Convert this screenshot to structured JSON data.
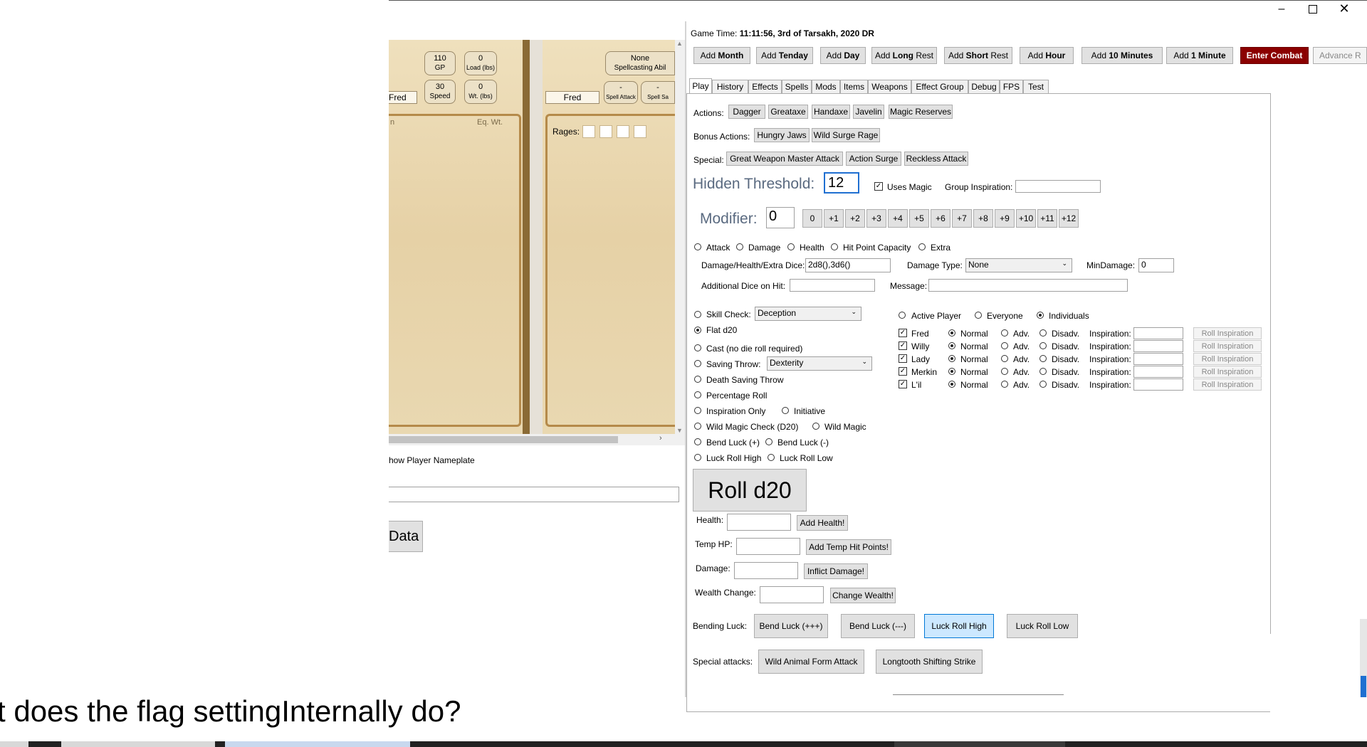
{
  "window": {
    "minimize_icon": "minimize-icon",
    "maximize_icon": "maximize-icon",
    "close_icon": "close-icon"
  },
  "game_time": {
    "label": "Game Time:",
    "value": "11:11:56, 3rd of Tarsakh, 2020 DR"
  },
  "time_buttons": [
    {
      "prefix": "Add ",
      "bold": "Month"
    },
    {
      "prefix": "Add ",
      "bold": "Tenday"
    },
    {
      "prefix": "Add ",
      "bold": "Day"
    },
    {
      "prefix": "Add ",
      "bold": "Long",
      "suffix": " Rest"
    },
    {
      "prefix": "Add ",
      "bold": "Short",
      "suffix": " Rest"
    },
    {
      "prefix": "Add ",
      "bold": "Hour"
    },
    {
      "prefix": "Add ",
      "bold": "10 Minutes"
    },
    {
      "prefix": "Add ",
      "bold": "1 Minute"
    }
  ],
  "enter_combat": "Enter Combat",
  "advance": "Advance R",
  "tabs": [
    "Play",
    "History",
    "Effects",
    "Spells",
    "Mods",
    "Items",
    "Weapons",
    "Effect Group",
    "Debug",
    "FPS",
    "Test"
  ],
  "actions": {
    "label": "Actions:",
    "items": [
      "Dagger",
      "Greataxe",
      "Handaxe",
      "Javelin",
      "Magic Reserves"
    ]
  },
  "bonus_actions": {
    "label": "Bonus Actions:",
    "items": [
      "Hungry Jaws",
      "Wild Surge Rage"
    ]
  },
  "special": {
    "label": "Special:",
    "items": [
      "Great Weapon Master Attack",
      "Action Surge",
      "Reckless Attack"
    ]
  },
  "hidden_threshold": {
    "label": "Hidden Threshold:",
    "value": "12"
  },
  "uses_magic": {
    "label": "Uses Magic",
    "checked": true
  },
  "group_inspiration": {
    "label": "Group Inspiration:",
    "value": ""
  },
  "modifier": {
    "label": "Modifier:",
    "value": "0",
    "buttons": [
      "0",
      "+1",
      "+2",
      "+3",
      "+4",
      "+5",
      "+6",
      "+7",
      "+8",
      "+9",
      "+10",
      "+11",
      "+12"
    ]
  },
  "roll_type": [
    "Attack",
    "Damage",
    "Health",
    "Hit Point Capacity",
    "Extra"
  ],
  "dice": {
    "label": "Damage/Health/Extra Dice:",
    "value": "2d8(),3d6()"
  },
  "damage_type": {
    "label": "Damage Type:",
    "value": "None"
  },
  "min_damage": {
    "label": "MinDamage:",
    "value": "0"
  },
  "additional_dice": {
    "label": "Additional Dice on Hit:",
    "value": ""
  },
  "message": {
    "label": "Message:",
    "value": ""
  },
  "checks": {
    "skill_check": {
      "label": "Skill Check:",
      "value": "Deception"
    },
    "flat_d20": "Flat d20",
    "cast": "Cast (no die roll required)",
    "saving_throw": {
      "label": "Saving Throw:",
      "value": "Dexterity"
    },
    "death_saving": "Death Saving Throw",
    "percentage": "Percentage Roll",
    "inspiration_only": "Inspiration Only",
    "initiative": "Initiative",
    "wild_magic_check": "Wild Magic Check (D20)",
    "wild_magic": "Wild Magic",
    "bend_luck_plus": "Bend Luck (+)",
    "bend_luck_minus": "Bend Luck (-)",
    "luck_roll_high": "Luck Roll High",
    "luck_roll_low": "Luck Roll Low"
  },
  "target": {
    "active_player": "Active Player",
    "everyone": "Everyone",
    "individuals": "Individuals"
  },
  "players": [
    {
      "name": "Fred"
    },
    {
      "name": "Willy"
    },
    {
      "name": "Lady"
    },
    {
      "name": "Merkin"
    },
    {
      "name": "L'il"
    }
  ],
  "player_cols": {
    "normal": "Normal",
    "adv": "Adv.",
    "disadv": "Disadv.",
    "inspiration": "Inspiration:",
    "roll_insp": "Roll Inspiration"
  },
  "roll_button": "Roll d20",
  "health": {
    "label": "Health:",
    "button": "Add Health!"
  },
  "temp_hp": {
    "label": "Temp HP:",
    "button": "Add Temp Hit Points!"
  },
  "damage": {
    "label": "Damage:",
    "button": "Inflict Damage!"
  },
  "wealth": {
    "label": "Wealth Change:",
    "button": "Change Wealth!"
  },
  "bending_luck": {
    "label": "Bending Luck:",
    "items": [
      "Bend Luck (+++)",
      "Bend Luck (---)",
      "Luck Roll High",
      "Luck Roll Low"
    ]
  },
  "special_attacks": {
    "label": "Special attacks:",
    "items": [
      "Wild Animal Form Attack",
      "Longtooth Shifting Strike"
    ]
  },
  "left": {
    "sheet1": {
      "gp": "110",
      "gp_label": "GP",
      "load": "0",
      "load_label": "Load (lbs)",
      "speed": "30",
      "speed_label": "Speed",
      "wt": "0",
      "wt_label": "Wt. (lbs)",
      "name": "Fred",
      "col_left": "n",
      "col_right": "Eq. Wt."
    },
    "sheet2": {
      "spell_value": "None",
      "spell_label": "Spellcasting Abil",
      "name": "Fred",
      "attack": "-",
      "attack_label": "Spell Attack",
      "save": "-",
      "save_label": "Spell Sa",
      "rages_label": "Rages:"
    },
    "nameplate": "how Player Nameplate",
    "data_button": "Data"
  },
  "question": "t does the flag settingInternally do?"
}
